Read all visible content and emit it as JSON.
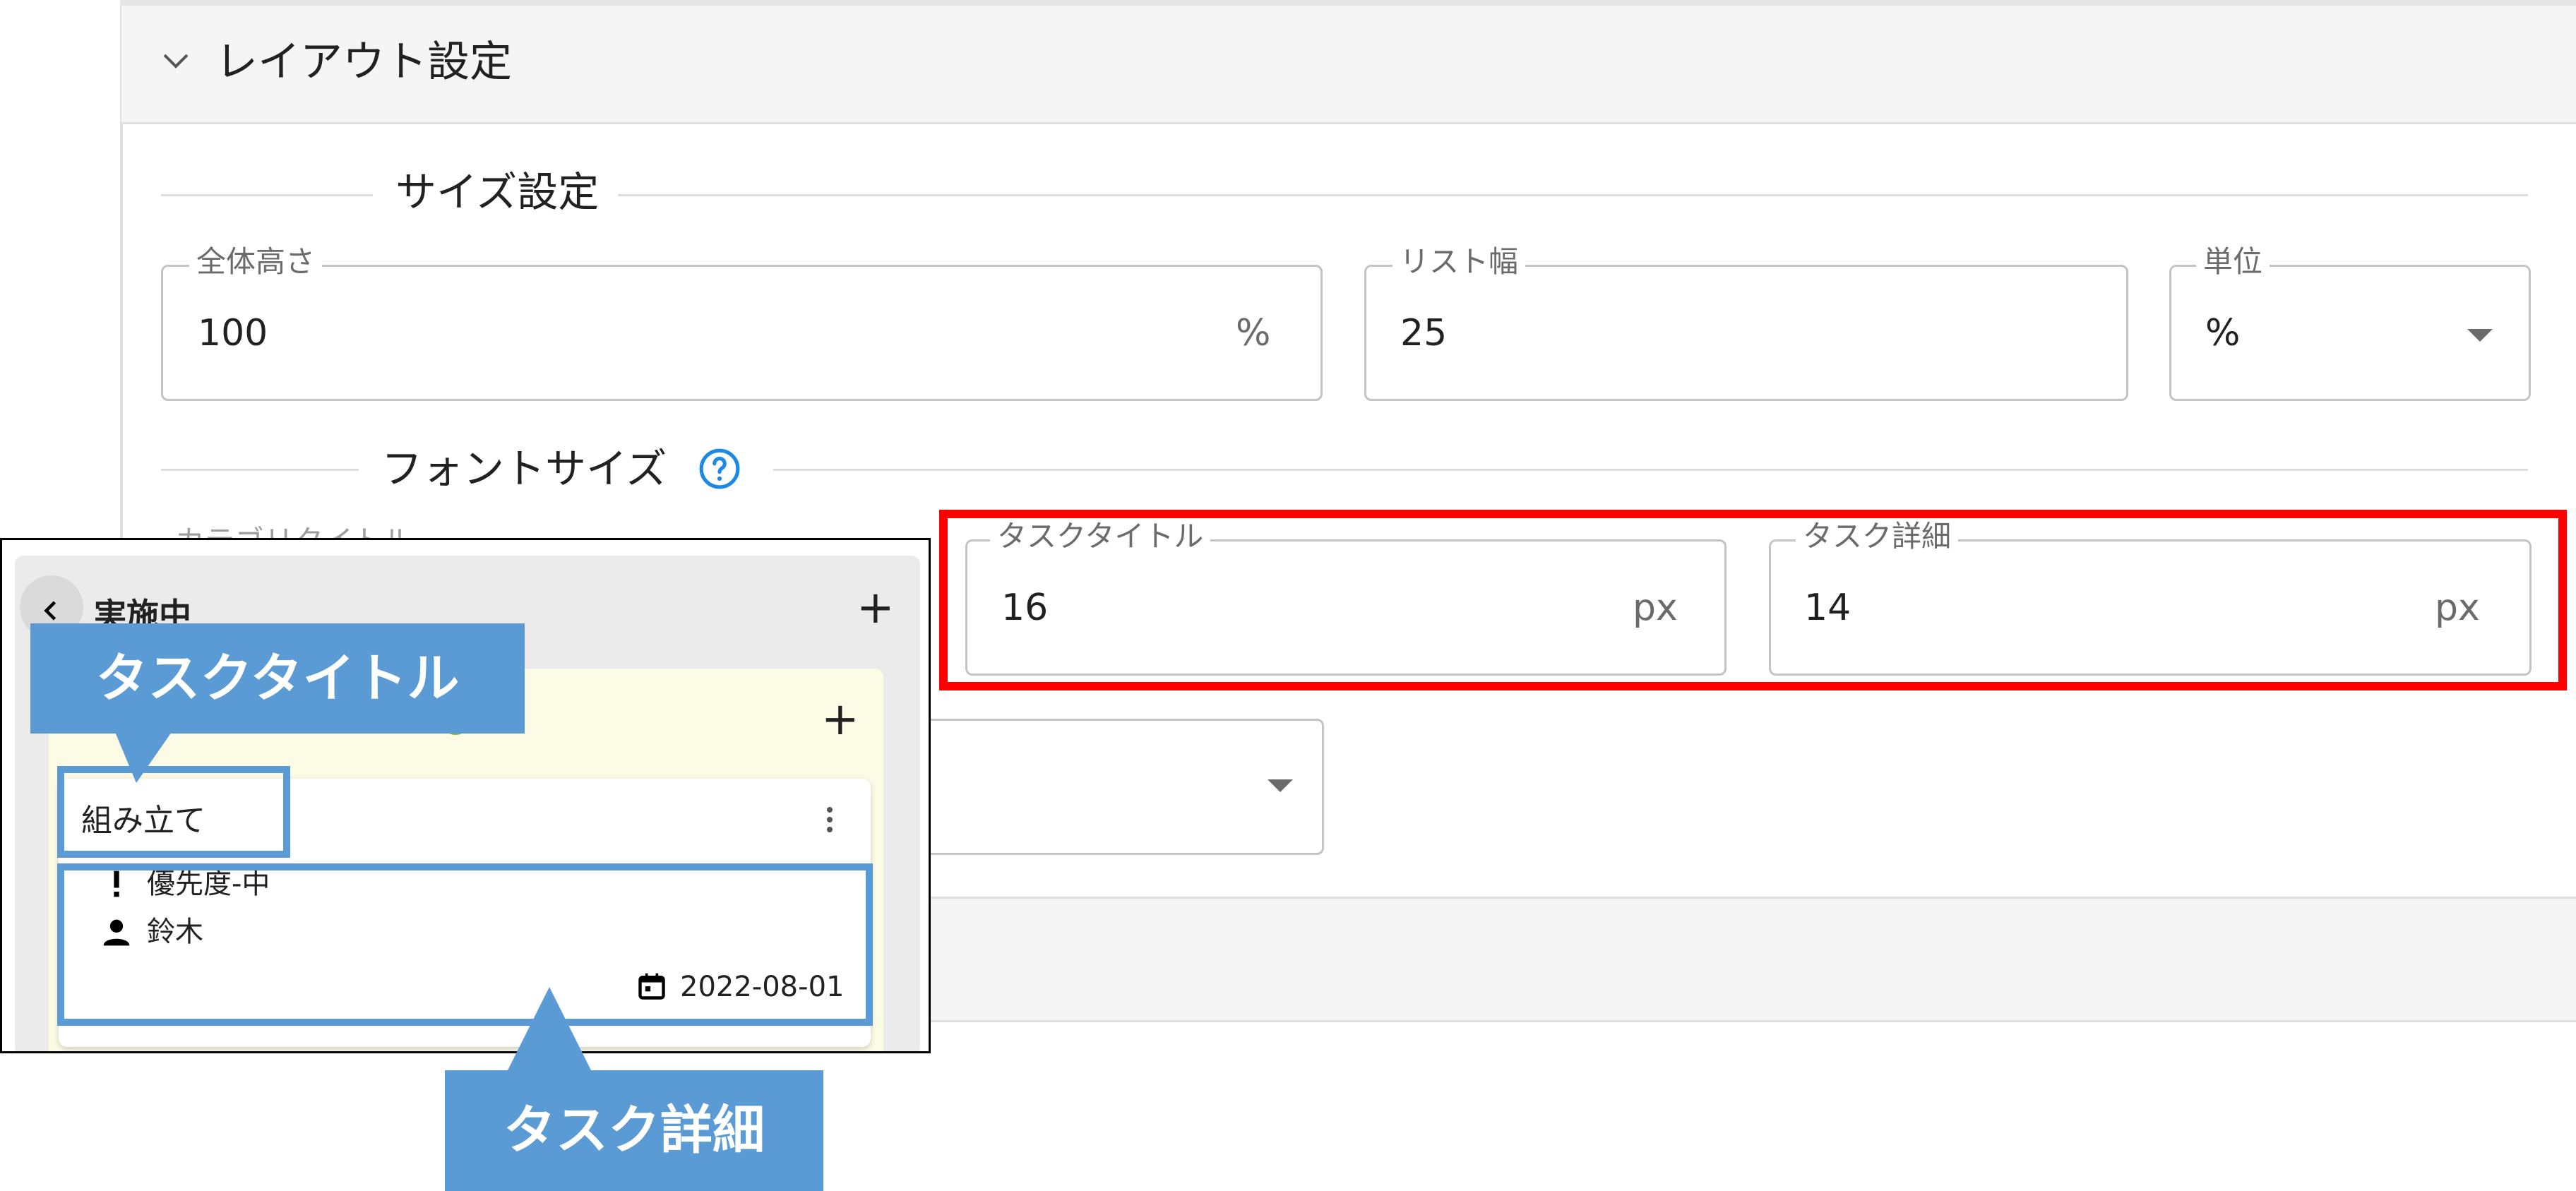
{
  "accordion": {
    "title": "レイアウト設定"
  },
  "size_section": {
    "heading": "サイズ設定",
    "height_field": {
      "label": "全体高さ",
      "value": "100",
      "unit": "%"
    },
    "list_width_field": {
      "label": "リスト幅",
      "value": "25"
    },
    "unit_select": {
      "label": "単位",
      "value": "%"
    }
  },
  "font_section": {
    "heading": "フォントサイズ",
    "help_icon": "help-circle-icon",
    "category_title_label": "カテゴリタイトル",
    "task_title_field": {
      "label": "タスクタイトル",
      "value": "16",
      "unit": "px"
    },
    "task_detail_field": {
      "label": "タスク詳細",
      "value": "14",
      "unit": "px"
    }
  },
  "preview": {
    "column_title": "実施中",
    "task_title": "組み立て",
    "priority": "優先度-中",
    "assignee": "鈴木",
    "date": "2022-08-01",
    "icons": [
      "back-icon",
      "plus-icon",
      "kebab-menu-icon",
      "exclamation-icon",
      "person-icon",
      "calendar-icon"
    ]
  },
  "callouts": {
    "task_title": "タスクタイトル",
    "task_detail": "タスク詳細"
  },
  "colors": {
    "highlight_red": "#ff0000",
    "callout_blue": "#5b9bd5",
    "help_blue": "#1e88e5",
    "group_bg": "#fbfbe6",
    "status_dot": "#7cb342"
  }
}
